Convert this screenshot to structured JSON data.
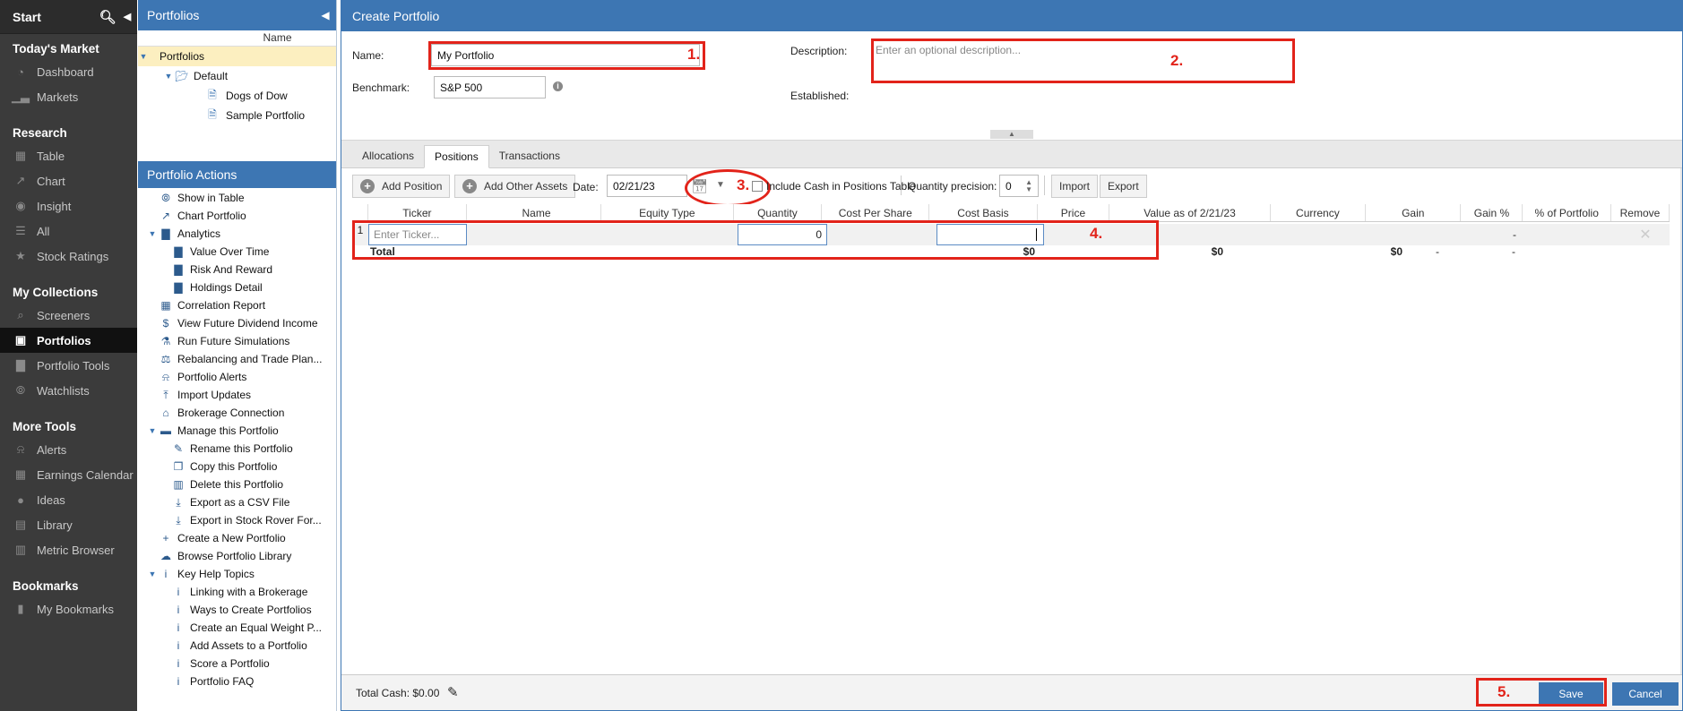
{
  "nav": {
    "start": "Start",
    "sections": [
      {
        "title": "Today's Market",
        "items": [
          {
            "label": "Dashboard",
            "icon": "dashboard-icon"
          },
          {
            "label": "Markets",
            "icon": "markets-icon"
          }
        ]
      },
      {
        "title": "Research",
        "items": [
          {
            "label": "Table",
            "icon": "table-icon"
          },
          {
            "label": "Chart",
            "icon": "chart-icon"
          },
          {
            "label": "Insight",
            "icon": "insight-icon"
          },
          {
            "label": "All",
            "icon": "all-icon"
          },
          {
            "label": "Stock Ratings",
            "icon": "star-icon"
          }
        ]
      },
      {
        "title": "My Collections",
        "items": [
          {
            "label": "Screeners",
            "icon": "search-icon"
          },
          {
            "label": "Portfolios",
            "icon": "briefcase-icon"
          },
          {
            "label": "Portfolio Tools",
            "icon": "portfolio-tools-icon"
          },
          {
            "label": "Watchlists",
            "icon": "binoculars-icon"
          }
        ]
      },
      {
        "title": "More Tools",
        "items": [
          {
            "label": "Alerts",
            "icon": "bell-icon"
          },
          {
            "label": "Earnings Calendar",
            "icon": "calendar-icon"
          },
          {
            "label": "Ideas",
            "icon": "bulb-icon"
          },
          {
            "label": "Library",
            "icon": "library-icon"
          },
          {
            "label": "Metric Browser",
            "icon": "metric-browser-icon"
          }
        ]
      },
      {
        "title": "Bookmarks",
        "items": [
          {
            "label": "My Bookmarks",
            "icon": "bookmark-icon"
          }
        ]
      }
    ]
  },
  "portfolios_panel": {
    "title": "Portfolios",
    "col_name": "Name",
    "tree": {
      "root": "Portfolios",
      "folder": "Default",
      "items": [
        "Dogs of Dow",
        "Sample Portfolio"
      ]
    }
  },
  "actions_panel": {
    "title": "Portfolio Actions",
    "items": [
      {
        "label": "Show in Table",
        "level": 0,
        "icon": "binoculars-icon"
      },
      {
        "label": "Chart Portfolio",
        "level": 0,
        "icon": "chart-icon"
      },
      {
        "label": "Analytics",
        "level": 0,
        "icon": "bar-chart-icon",
        "expand": true
      },
      {
        "label": "Value Over Time",
        "level": 1,
        "icon": "bar-chart-icon"
      },
      {
        "label": "Risk And Reward",
        "level": 1,
        "icon": "bar-chart-icon"
      },
      {
        "label": "Holdings Detail",
        "level": 1,
        "icon": "bar-chart-icon"
      },
      {
        "label": "Correlation Report",
        "level": 0,
        "icon": "grid-icon"
      },
      {
        "label": "View Future Dividend Income",
        "level": 0,
        "icon": "dollar-icon"
      },
      {
        "label": "Run Future Simulations",
        "level": 0,
        "icon": "flask-icon"
      },
      {
        "label": "Rebalancing and Trade Plan...",
        "level": 0,
        "icon": "scale-icon"
      },
      {
        "label": "Portfolio Alerts",
        "level": 0,
        "icon": "bell-icon"
      },
      {
        "label": "Import Updates",
        "level": 0,
        "icon": "upload-icon"
      },
      {
        "label": "Brokerage Connection",
        "level": 0,
        "icon": "bank-icon"
      },
      {
        "label": "Manage this Portfolio",
        "level": 0,
        "icon": "folder-icon",
        "expand": true
      },
      {
        "label": "Rename this Portfolio",
        "level": 1,
        "icon": "edit-icon"
      },
      {
        "label": "Copy this Portfolio",
        "level": 1,
        "icon": "copy-icon"
      },
      {
        "label": "Delete this Portfolio",
        "level": 1,
        "icon": "trash-icon"
      },
      {
        "label": "Export as a CSV File",
        "level": 1,
        "icon": "download-icon"
      },
      {
        "label": "Export in Stock Rover For...",
        "level": 1,
        "icon": "download-icon"
      },
      {
        "label": "Create a New Portfolio",
        "level": 0,
        "icon": "plus-icon"
      },
      {
        "label": "Browse Portfolio Library",
        "level": 0,
        "icon": "cloud-download-icon"
      },
      {
        "label": "Key Help Topics",
        "level": 0,
        "icon": "info-icon",
        "expand": true
      },
      {
        "label": "Linking with a Brokerage",
        "level": 1,
        "icon": "info-icon"
      },
      {
        "label": "Ways to Create Portfolios",
        "level": 1,
        "icon": "info-icon"
      },
      {
        "label": "Create an Equal Weight P...",
        "level": 1,
        "icon": "info-icon"
      },
      {
        "label": "Add Assets to a Portfolio",
        "level": 1,
        "icon": "info-icon"
      },
      {
        "label": "Score a Portfolio",
        "level": 1,
        "icon": "info-icon"
      },
      {
        "label": "Portfolio FAQ",
        "level": 1,
        "icon": "info-icon"
      }
    ]
  },
  "main": {
    "title": "Create Portfolio",
    "name_label": "Name:",
    "name_value": "My Portfolio",
    "benchmark_label": "Benchmark:",
    "benchmark_value": "S&P 500",
    "description_label": "Description:",
    "description_placeholder": "Enter an optional description...",
    "established_label": "Established:",
    "tabs": [
      "Allocations",
      "Positions",
      "Transactions"
    ],
    "active_tab": "Positions"
  },
  "toolbar": {
    "add_position": "Add Position",
    "add_other_assets": "Add Other Assets",
    "date_label": "Date:",
    "date_value": "02/21/23",
    "include_cash_label": "Include Cash in Positions Table",
    "include_cash_checked": false,
    "quantity_precision_label": "Quantity precision:",
    "quantity_precision_value": "0",
    "import": "Import",
    "export": "Export"
  },
  "grid": {
    "columns": [
      "Ticker",
      "Name",
      "Equity Type",
      "Quantity",
      "Cost Per Share",
      "Cost Basis",
      "Price",
      "Value as of 2/21/23",
      "Currency",
      "Gain",
      "Gain %",
      "% of Portfolio",
      "Remove"
    ],
    "row": {
      "num": "1",
      "ticker_placeholder": "Enter Ticker...",
      "quantity": "0",
      "gain_pct": "-"
    },
    "total": {
      "label": "Total",
      "price": "$0",
      "value": "$0",
      "gain": "$0",
      "gain_pct": "-",
      "pct_portfolio": "-"
    }
  },
  "footer": {
    "total_cash": "Total Cash: $0.00",
    "save": "Save",
    "cancel": "Cancel"
  },
  "annotations": [
    "1.",
    "2.",
    "3.",
    "4.",
    "5."
  ],
  "colors": {
    "accent": "#3d76b3",
    "annotation": "#e2231a",
    "nav_bg": "#3b3b3b"
  }
}
